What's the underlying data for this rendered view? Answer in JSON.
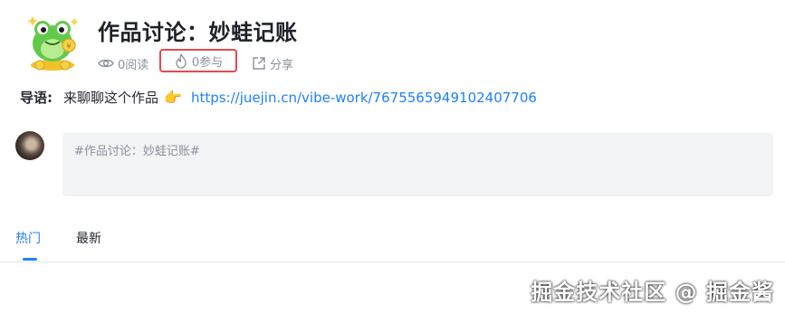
{
  "header": {
    "title": "作品讨论：妙蛙记账",
    "stats": {
      "read_label": "0阅读",
      "join_label": "0参与",
      "share_label": "分享"
    }
  },
  "guide": {
    "label": "导语:",
    "text": "来聊聊这个作品",
    "emoji": "👉",
    "link": "https://juejin.cn/vibe-work/7675565949102407706"
  },
  "editor": {
    "content": "#作品讨论：妙蛙记账#"
  },
  "tabs": [
    {
      "label": "热门",
      "active": true
    },
    {
      "label": "最新",
      "active": false
    }
  ],
  "watermark": "掘金技术社区 @ 掘金酱",
  "colors": {
    "accent": "#1e80ff",
    "highlight_border": "#e5484d",
    "muted_text": "#8a919f",
    "editor_bg": "#f2f3f5"
  },
  "icons": {
    "read": "eye-icon",
    "join": "flame-icon",
    "share": "share-icon"
  }
}
